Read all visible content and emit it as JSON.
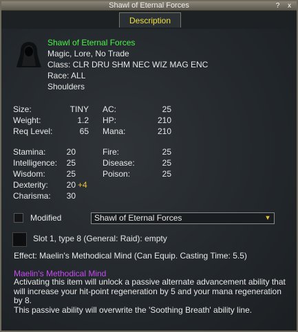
{
  "window": {
    "title": "Shawl of Eternal Forces",
    "help_button": "?",
    "close_button": "x"
  },
  "tabs": [
    {
      "label": "Description"
    }
  ],
  "item": {
    "name": "Shawl of Eternal Forces",
    "flags": "Magic, Lore, No Trade",
    "classes": "Class: CLR DRU SHM NEC WIZ MAG ENC",
    "race": "Race: ALL",
    "slot": "Shoulders",
    "icon": "shawl-icon"
  },
  "stats_left": [
    {
      "label": "Size:",
      "value": "TINY"
    },
    {
      "label": "Weight:",
      "value": "1.2"
    },
    {
      "label": "Req Level:",
      "value": "65"
    }
  ],
  "stats_mid": [
    {
      "label": "AC:",
      "value": "25"
    },
    {
      "label": "HP:",
      "value": "210"
    },
    {
      "label": "Mana:",
      "value": "210"
    }
  ],
  "attributes": [
    {
      "label": "Stamina:",
      "value": "20",
      "bonus": ""
    },
    {
      "label": "Intelligence:",
      "value": "25",
      "bonus": ""
    },
    {
      "label": "Wisdom:",
      "value": "25",
      "bonus": ""
    },
    {
      "label": "Dexterity:",
      "value": "20",
      "bonus": "+4"
    },
    {
      "label": "Charisma:",
      "value": "30",
      "bonus": ""
    }
  ],
  "resists": [
    {
      "label": "Fire:",
      "value": "25"
    },
    {
      "label": "Disease:",
      "value": "25"
    },
    {
      "label": "Poison:",
      "value": "25"
    }
  ],
  "modified": {
    "label": "Modified",
    "checked": false,
    "dropdown_value": "Shawl of Eternal Forces"
  },
  "augment_slot": "Slot 1, type 8 (General: Raid): empty",
  "effect": "Effect: Maelin's Methodical Mind (Can Equip. Casting Time: 5.5)",
  "spell": {
    "name": "Maelin's Methodical Mind",
    "description": "Activating this item will unlock a passive alternate advancement ability that will increase your hit-point regeneration by 5 and your mana regeneration by 8.",
    "note": "This passive ability will overwrite the 'Soothing Breath' ability line."
  },
  "colors": {
    "item_name": "#4cf24c",
    "spell_name": "#c64cf2",
    "tab_text": "#f0e040",
    "bonus": "#e8c43a"
  }
}
